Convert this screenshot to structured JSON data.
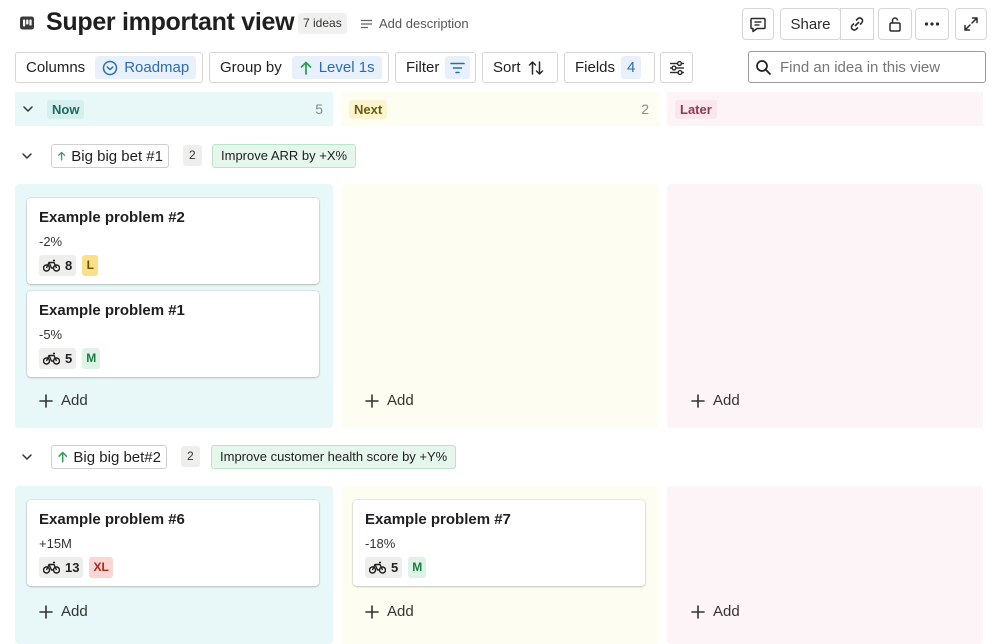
{
  "header": {
    "title": "Super important view",
    "count_label": "7 ideas",
    "add_description": "Add description",
    "share_label": "Share"
  },
  "toolbar": {
    "columns_label": "Columns",
    "columns_value": "Roadmap",
    "group_label": "Group by",
    "group_value": "Level 1s",
    "filter_label": "Filter",
    "sort_label": "Sort",
    "fields_label": "Fields",
    "fields_count": "4",
    "search_placeholder": "Find an idea in this view"
  },
  "columns": [
    {
      "label": "Now",
      "count": "5",
      "color": "#e8f7f7",
      "tag_bg": "#d5f0ef",
      "tag_color": "#1d6b64"
    },
    {
      "label": "Next",
      "count": "2",
      "color": "#fefdf1",
      "tag_bg": "#fbf5cf",
      "tag_color": "#6b5b0f"
    },
    {
      "label": "Later",
      "count": "",
      "color": "#fdf4f7",
      "tag_bg": "#fbe6ee",
      "tag_color": "#8a3a57"
    }
  ],
  "groups": [
    {
      "name": "Big big bet #1",
      "count": "2",
      "tag": "Improve ARR by +X%",
      "cards_now": [
        {
          "title": "Example problem #2",
          "metric": "-2%",
          "effort": "8",
          "size": "L",
          "size_bg": "#fbe08a",
          "size_color": "#6b5200"
        },
        {
          "title": "Example problem #1",
          "metric": "-5%",
          "effort": "5",
          "size": "M",
          "size_bg": "#ddf3e6",
          "size_color": "#1e7a47"
        }
      ]
    },
    {
      "name": "Big big bet#2",
      "count": "2",
      "tag": "Improve customer health score by +Y%",
      "cards_now": [
        {
          "title": "Example problem #6",
          "metric": "+15M",
          "effort": "13",
          "size": "XL",
          "size_bg": "#fbd6d3",
          "size_color": "#b3261e"
        }
      ],
      "cards_next": [
        {
          "title": "Example problem #7",
          "metric": "-18%",
          "effort": "5",
          "size": "M",
          "size_bg": "#ddf3e6",
          "size_color": "#1e7a47"
        }
      ]
    }
  ],
  "add_label": "Add",
  "icons": {
    "view": "board-icon",
    "comment": "comment-icon",
    "link": "link-icon",
    "lock": "unlock-icon",
    "more": "more-icon",
    "expand": "expand-icon",
    "roadmap": "roadmap-icon",
    "level": "arrow-up-icon",
    "filter": "filter-icon",
    "sort": "sort-icon",
    "fields": "sliders-icon",
    "search": "search-icon",
    "effort": "bike-icon",
    "add": "plus-icon",
    "collapse": "chevron-down-icon"
  }
}
